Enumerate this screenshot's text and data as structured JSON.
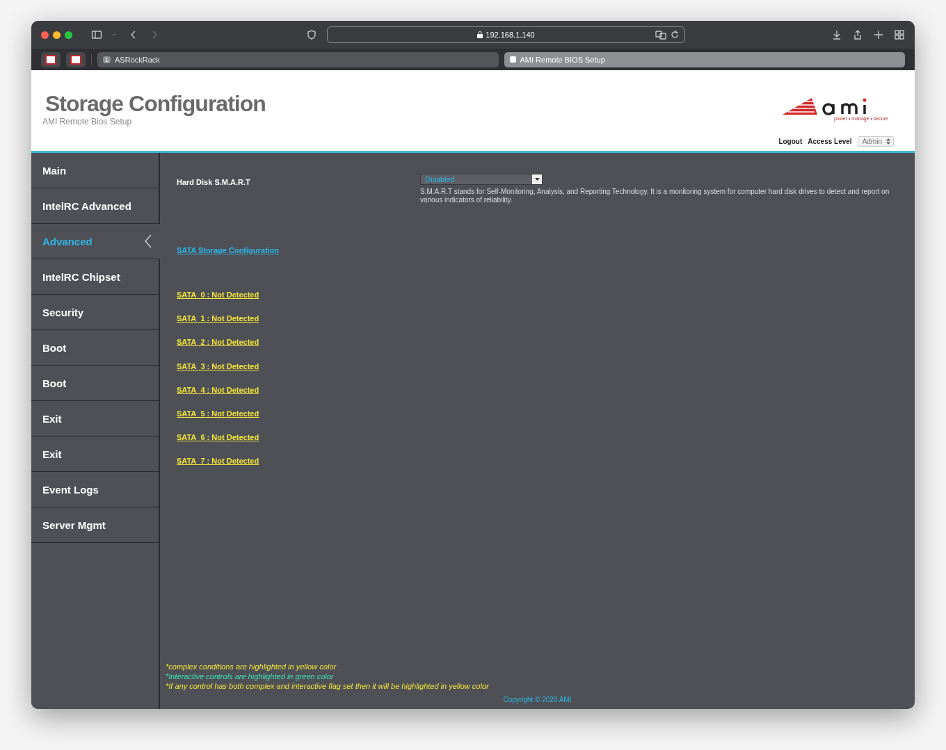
{
  "browser": {
    "address": "192.168.1.140",
    "tabs": [
      {
        "label": "ASRockRack",
        "badge": "1",
        "selected": false
      },
      {
        "label": "AMI Remote BIOS Setup",
        "selected": true
      }
    ]
  },
  "header": {
    "title": "Storage Configuration",
    "subtitle": "AMI Remote Bios Setup",
    "logo_tagline": "power • manage • secure",
    "logout": "Logout",
    "access_level_label": "Access Level",
    "access_level": "Admin"
  },
  "sidebar": {
    "items": [
      {
        "label": "Main",
        "selected": false
      },
      {
        "label": "IntelRC Advanced",
        "selected": false
      },
      {
        "label": "Advanced",
        "selected": true
      },
      {
        "label": "IntelRC Chipset",
        "selected": false
      },
      {
        "label": "Security",
        "selected": false
      },
      {
        "label": "Boot",
        "selected": false
      },
      {
        "label": "Boot",
        "selected": false
      },
      {
        "label": "Exit",
        "selected": false
      },
      {
        "label": "Exit",
        "selected": false
      },
      {
        "label": "Event Logs",
        "selected": false
      },
      {
        "label": "Server Mgmt",
        "selected": false
      }
    ]
  },
  "setting": {
    "label": "Hard Disk S.M.A.R.T",
    "value": "Disabled",
    "help": "S.M.A.R.T stands for Self-Monitoring, Analysis, and Reporting Technology. It is a monitoring system for computer hard disk drives to detect and report on various indicators of reliability."
  },
  "section_link": "SATA Storage Configuration",
  "ports": [
    "SATA_0 : Not Detected",
    "SATA_1 : Not Detected",
    "SATA_2 : Not Detected",
    "SATA_3 : Not Detected",
    "SATA_4 : Not Detected",
    "SATA_5 : Not Detected",
    "SATA_6 : Not Detected",
    "SATA_7 : Not Detected"
  ],
  "notes": [
    {
      "text": "*complex conditions are highlighted in yellow color",
      "color": "#f2e63a"
    },
    {
      "text": "*Interactive controls are highlighted in green color",
      "color": "#3fe0b0"
    },
    {
      "text": "*If any control has both complex and interactive flag set then it will be highlighted in yellow color",
      "color": "#f2e63a"
    }
  ],
  "copyright": "Copyright © 2020 AMI"
}
